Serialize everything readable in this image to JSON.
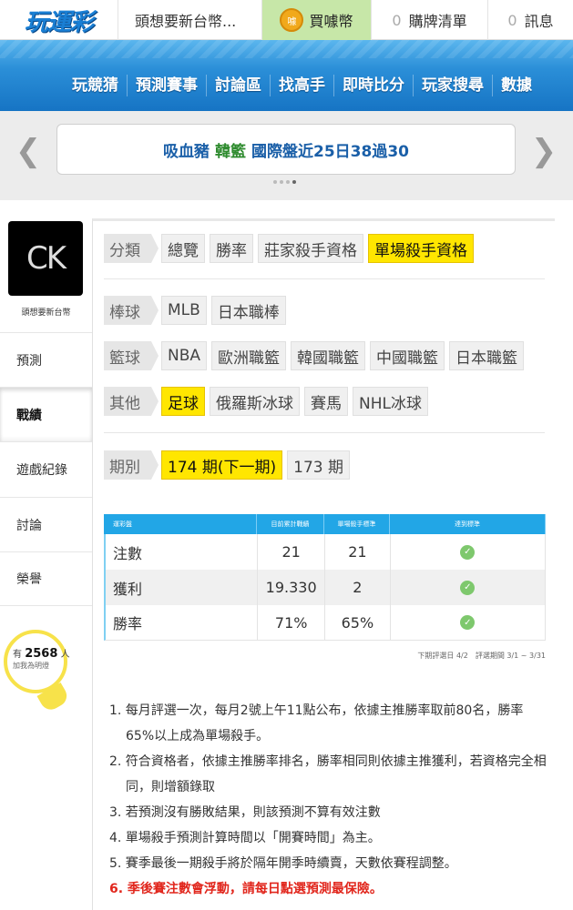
{
  "topbar": {
    "logo": "玩運彩",
    "user": "頭想要新台幣...",
    "buy_label": "買噱幣",
    "coin_icon_text": "噱",
    "cart_count": "0",
    "cart_label": "購牌清單",
    "msg_count": "0",
    "msg_label": "訊息"
  },
  "nav": [
    "玩競猜",
    "預測賽事",
    "討論區",
    "找高手",
    "即時比分",
    "玩家搜尋",
    "數據"
  ],
  "ticker": {
    "name": "吸血豬",
    "league": "韓籃",
    "text": "國際盤近25日38過30"
  },
  "sidebar": {
    "avatar_text": "CK",
    "username": "頭想要新台幣",
    "items": [
      "預測",
      "戰績",
      "遊戲紀錄",
      "討論",
      "榮譽"
    ],
    "fans_prefix": "有",
    "fans_count": "2568",
    "fans_suffix": "人",
    "fans_sub": "加我為明燈"
  },
  "filters": {
    "category": {
      "label": "分類",
      "items": [
        "總覽",
        "勝率",
        "莊家殺手資格",
        "單場殺手資格"
      ],
      "selected": 3
    },
    "baseball": {
      "label": "棒球",
      "items": [
        "MLB",
        "日本職棒"
      ]
    },
    "basketball": {
      "label": "籃球",
      "items": [
        "NBA",
        "歐洲職籃",
        "韓國職籃",
        "中國職籃",
        "日本職籃"
      ]
    },
    "other": {
      "label": "其他",
      "items": [
        "足球",
        "俄羅斯冰球",
        "賽馬",
        "NHL冰球"
      ],
      "selected": 0
    },
    "period": {
      "label": "期別",
      "items": [
        "174 期(下一期)",
        "173 期"
      ],
      "selected": 0
    }
  },
  "stats": {
    "headers": [
      "運彩盤",
      "目前累計戰績",
      "單場殺手標準",
      "達到標準"
    ],
    "rows": [
      {
        "label": "注數",
        "current": "21",
        "standard": "21",
        "met": true
      },
      {
        "label": "獲利",
        "current": "19.330",
        "standard": "2",
        "met": true
      },
      {
        "label": "勝率",
        "current": "71%",
        "standard": "65%",
        "met": true
      }
    ],
    "note": "下期評選日 4/2　評選期間 3/1 ~ 3/31"
  },
  "rules": [
    "1. 每月評選一次，每月2號上午11點公布，依據主推勝率取前80名，勝率65%以上成為單場殺手。",
    "2. 符合資格者，依據主推勝率排名，勝率相同則依據主推獲利，若資格完全相同，則增額錄取",
    "3. 若預測沒有勝敗結果，則該預測不算有效注數",
    "4. 單場殺手預測計算時間以「開賽時間」為主。",
    "5. 賽季最後一期殺手將於隔年開季時續賣，天數依賽程調整。",
    "6. 季後賽注數會浮動，請每日點選預測最保險。"
  ],
  "colors": {
    "nav_blue": "#1f86d2",
    "selected_yellow": "#ffe600",
    "header_blue": "#22a6e6",
    "alert_red": "#e1261c",
    "check_green": "#7ec86d"
  }
}
